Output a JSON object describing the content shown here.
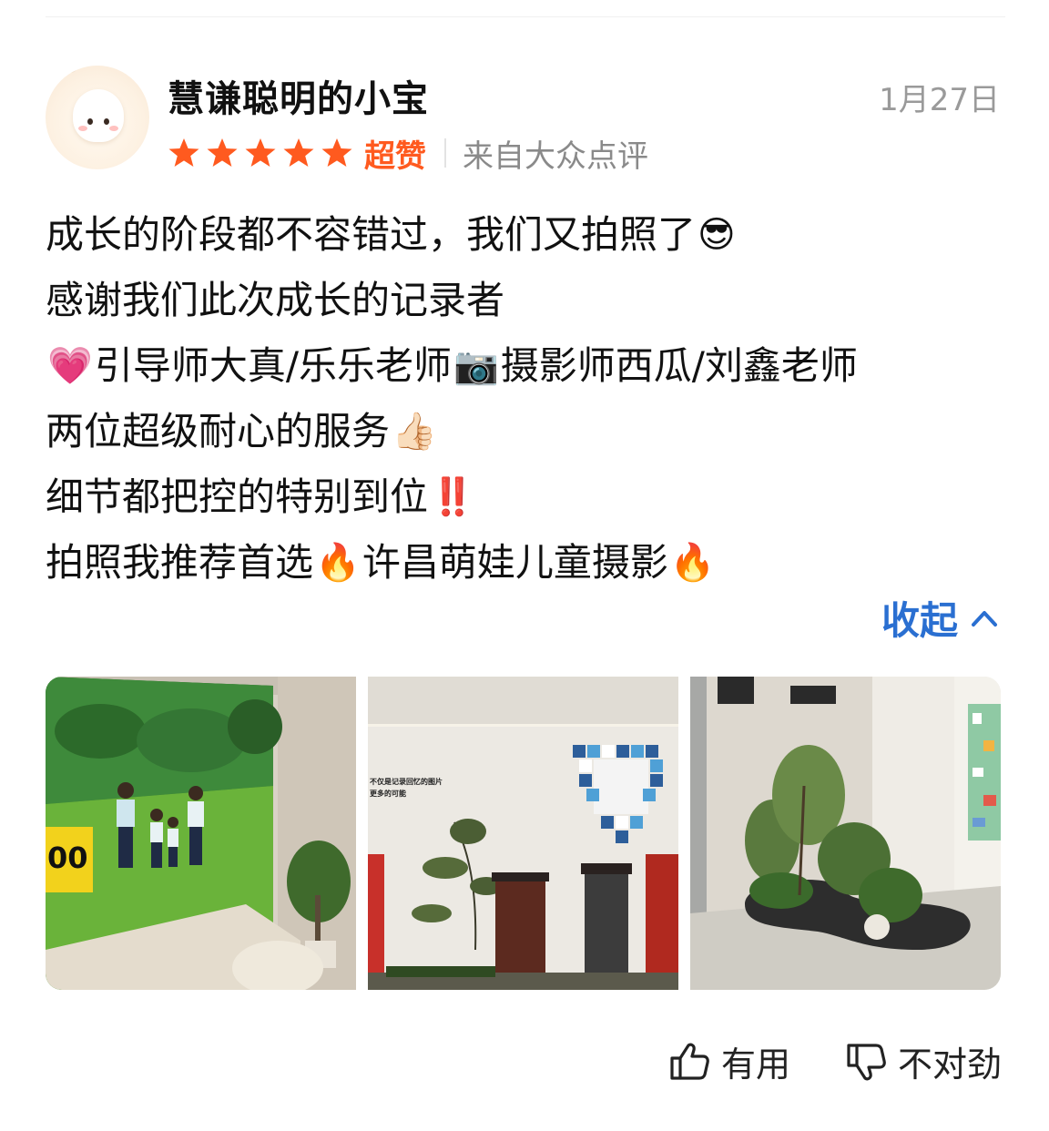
{
  "review": {
    "username": "慧谦聪明的小宝",
    "date": "1月27日",
    "rating_stars": 5,
    "rating_label": "超赞",
    "source": "来自大众点评",
    "lines": [
      {
        "a": "成长的阶段都不容错过，我们又拍照了",
        "e1": "😎"
      },
      {
        "a": "感谢我们此次成长的记录者"
      },
      {
        "e0": "💗",
        "a": "引导师大真/乐乐老师",
        "e1": "📷",
        "b": "摄影师西瓜/刘鑫老师"
      },
      {
        "a": "两位超级耐心的服务",
        "e1": "👍🏻"
      },
      {
        "a": "细节都把控的特别到位",
        "e1": "‼️"
      },
      {
        "a": "拍照我推荐首选",
        "e1": "🔥",
        "b": "许昌萌娃儿童摄影",
        "e2": "🔥"
      }
    ],
    "collapse_label": "收起",
    "photo_texts": {
      "screen_number": "00",
      "wall_line1": "不仅是记录回忆的图片",
      "wall_line2": "更多的可能"
    },
    "actions": {
      "useful_label": "有用",
      "wrong_label": "不对劲"
    }
  },
  "colors": {
    "accent_orange": "#ff5a1f",
    "link_blue": "#2a6fd1",
    "muted_gray": "#9a9a9a"
  },
  "icons": [
    "star-icon",
    "chevron-up-icon",
    "thumbs-up-icon",
    "thumbs-down-icon"
  ]
}
